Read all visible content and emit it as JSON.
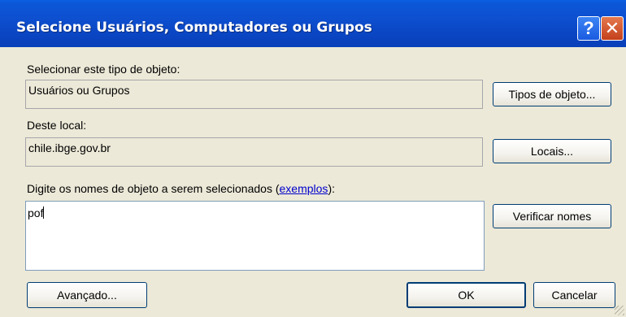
{
  "window": {
    "title": "Selecione Usuários, Computadores ou Grupos",
    "help_glyph": "?",
    "close_glyph": "✕"
  },
  "object_type": {
    "label": "Selecionar este tipo de objeto:",
    "value": "Usuários ou Grupos",
    "button": "Tipos de objeto..."
  },
  "location": {
    "label": "Deste local:",
    "value": "chile.ibge.gov.br",
    "button": "Locais..."
  },
  "names": {
    "label_prefix": "Digite os nomes de objeto a serem selecionados (",
    "examples_link": "exemplos",
    "label_suffix": "):",
    "value": "pof",
    "check_button": "Verificar nomes"
  },
  "footer": {
    "advanced_button": "Avançado...",
    "ok_button": "OK",
    "cancel_button": "Cancelar"
  },
  "colors": {
    "titlebar": "#0a4fcf",
    "dialog_bg": "#ece9d8",
    "link": "#0000cc"
  }
}
